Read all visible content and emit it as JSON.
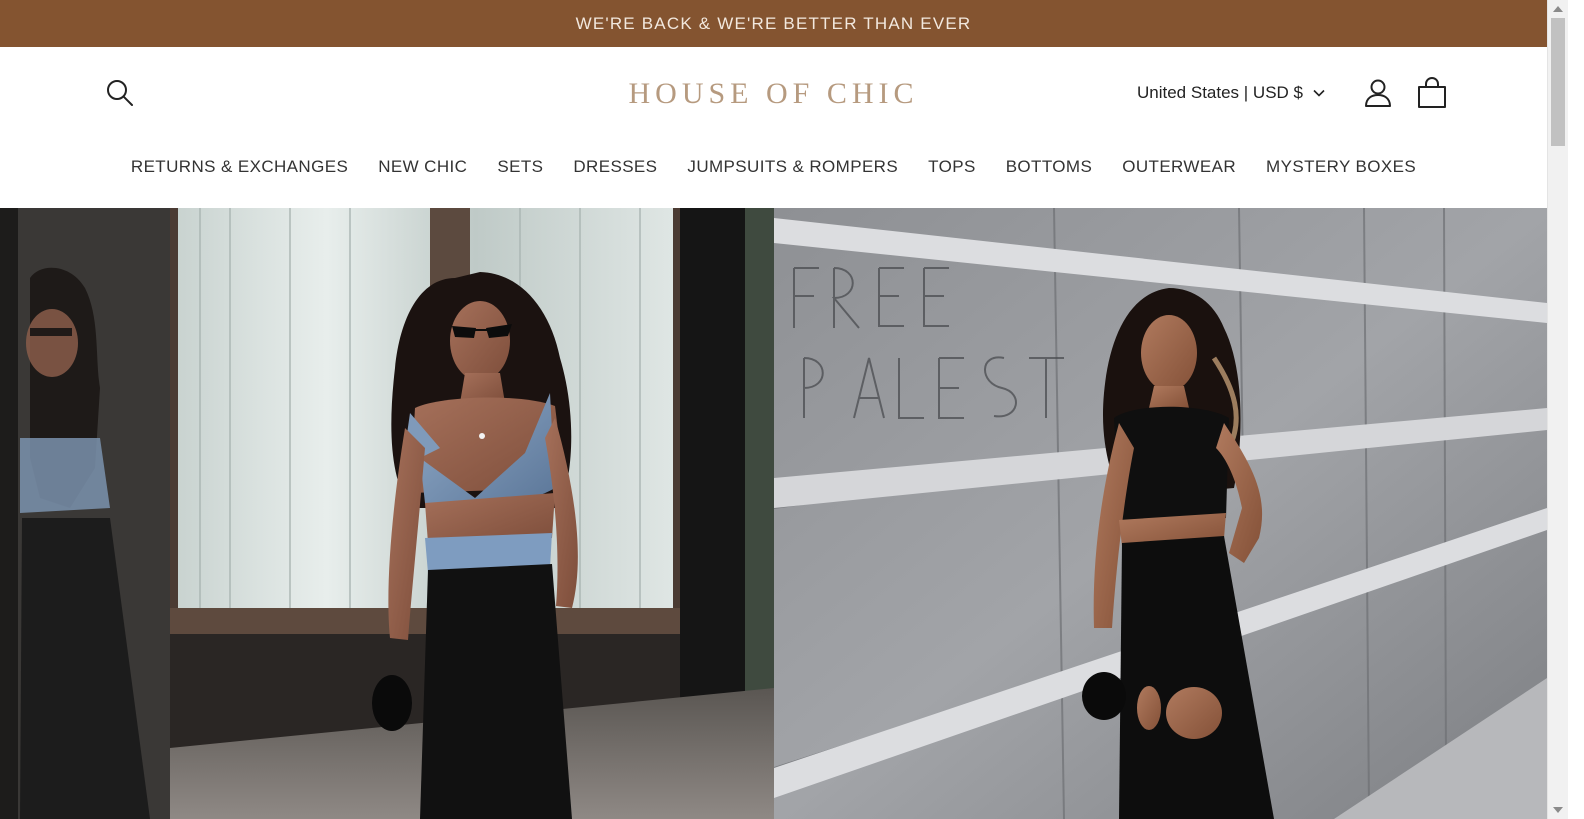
{
  "announcement": {
    "text": "WE'RE BACK & WE'RE BETTER THAN EVER"
  },
  "header": {
    "logo": "HOUSE OF CHIC",
    "country_selector": "United States | USD $",
    "icons": {
      "search": "search-icon",
      "account": "account-icon",
      "cart": "cart-icon",
      "dropdown": "chevron-down-icon"
    }
  },
  "nav": {
    "items": [
      "RETURNS & EXCHANGES",
      "NEW CHIC",
      "SETS",
      "DRESSES",
      "JUMPSUITS & ROMPERS",
      "TOPS",
      "BOTTOMS",
      "OUTERWEAR",
      "MYSTERY BOXES"
    ]
  },
  "hero": {
    "left_image": "model-denim-top-black-pants-photo",
    "right_image": "model-black-cutout-jumpsuit-photo",
    "graffiti_visible": "FREE PALESTINE"
  },
  "colors": {
    "announcement_bg": "#845430",
    "announcement_text": "#f2e8de",
    "logo": "#b69a7f",
    "nav_text": "#333333"
  }
}
